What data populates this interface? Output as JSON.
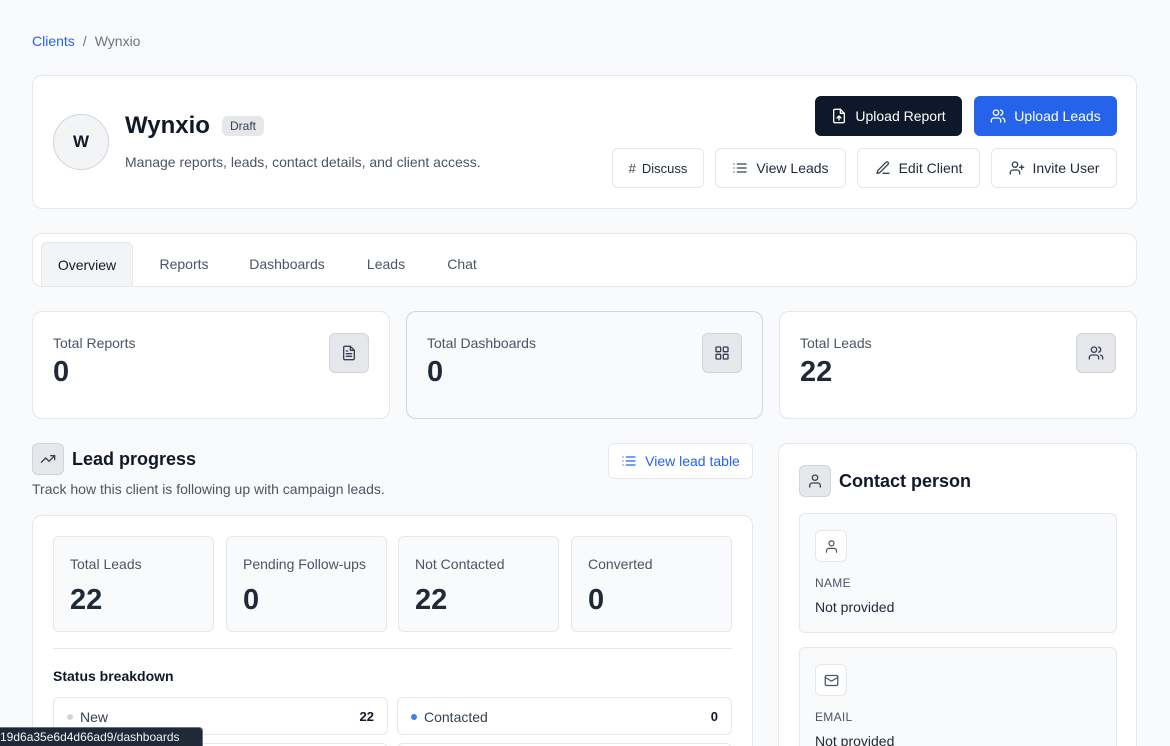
{
  "breadcrumb": {
    "root": "Clients",
    "separator": "/",
    "current": "Wynxio"
  },
  "client": {
    "avatar_initial": "W",
    "name": "Wynxio",
    "status": "Draft",
    "description": "Manage reports, leads, contact details, and client access."
  },
  "actions": {
    "upload_report": "Upload Report",
    "upload_leads": "Upload Leads",
    "discuss": "Discuss",
    "view_leads": "View Leads",
    "edit_client": "Edit Client",
    "invite_user": "Invite User"
  },
  "tabs": [
    {
      "label": "Overview",
      "active": true
    },
    {
      "label": "Reports"
    },
    {
      "label": "Dashboards"
    },
    {
      "label": "Leads"
    },
    {
      "label": "Chat"
    }
  ],
  "stats": [
    {
      "label": "Total Reports",
      "value": "0",
      "icon": "file-text-icon"
    },
    {
      "label": "Total Dashboards",
      "value": "0",
      "icon": "grid-icon"
    },
    {
      "label": "Total Leads",
      "value": "22",
      "icon": "users-icon"
    }
  ],
  "lead_progress": {
    "title": "Lead progress",
    "description": "Track how this client is following up with campaign leads.",
    "view_table": "View lead table",
    "metrics": [
      {
        "label": "Total Leads",
        "value": "22"
      },
      {
        "label": "Pending Follow-ups",
        "value": "0"
      },
      {
        "label": "Not Contacted",
        "value": "22"
      },
      {
        "label": "Converted",
        "value": "0"
      }
    ],
    "status_title": "Status breakdown",
    "statuses": [
      {
        "name": "New",
        "count": "22",
        "color": "#d1d5db"
      },
      {
        "name": "Contacted",
        "count": "0",
        "color": "#3b82f6"
      }
    ]
  },
  "contact": {
    "title": "Contact person",
    "fields": [
      {
        "label": "NAME",
        "value": "Not provided",
        "icon": "user-icon"
      },
      {
        "label": "EMAIL",
        "value": "Not provided",
        "icon": "mail-icon"
      }
    ]
  },
  "status_url": "19d6a35e6d4d66ad9/dashboards",
  "colors": {
    "primary": "#2563eb",
    "dark": "#0f172a",
    "border": "#e5e7eb",
    "background": "#f9fafb"
  }
}
